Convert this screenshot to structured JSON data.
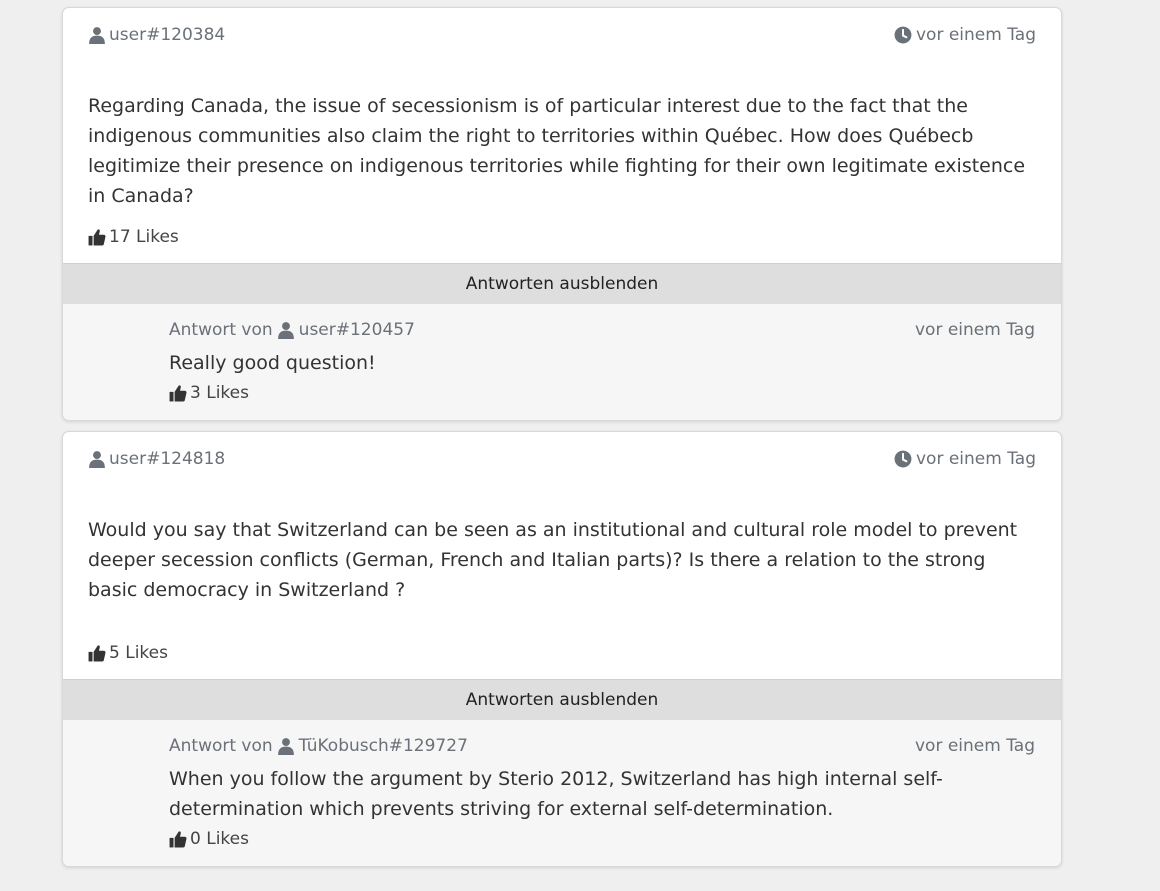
{
  "posts": [
    {
      "author": "user#120384",
      "time": "vor einem Tag",
      "text": "Regarding Canada, the issue of secessionism is of particular interest due to the fact that the indigenous communities also claim the right to territories within Québec. How does Québecb legitimize their presence on indigenous territories while fighting for their own legitimate existence in Canada?",
      "likes": "17 Likes",
      "toggle_label": "Antworten ausblenden",
      "reply": {
        "prefix": "Antwort von",
        "author": "user#120457",
        "time": "vor einem Tag",
        "text": "Really good question!",
        "likes": "3 Likes"
      }
    },
    {
      "author": "user#124818",
      "time": "vor einem Tag",
      "text": "Would you say that Switzerland can be seen as an institutional and cultural role model to prevent deeper secession conflicts (German, French and Italian parts)? Is there a relation to the strong basic democracy in Switzerland ?",
      "likes": "5 Likes",
      "toggle_label": "Antworten ausblenden",
      "reply": {
        "prefix": "Antwort von",
        "author": "TüKobusch#129727",
        "time": "vor einem Tag",
        "text": "When you follow the argument by Sterio 2012, Switzerland has high internal self-determination which prevents striving for external self-determination.",
        "likes": "0 Likes"
      }
    }
  ],
  "colors": {
    "background": "#efefef",
    "card": "#ffffff",
    "toggle_bar": "#dedede",
    "reply_bg": "#f6f6f6",
    "meta_text": "#6b7178"
  },
  "icons": {
    "user": "user-icon",
    "clock": "clock-icon",
    "like": "thumbs-up-icon"
  }
}
